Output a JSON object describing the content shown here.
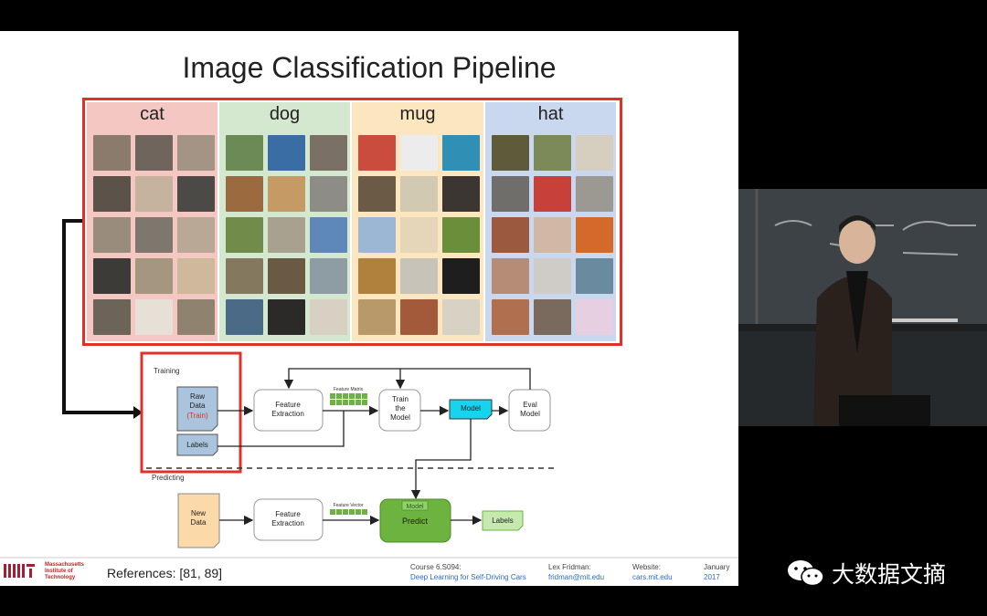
{
  "slide": {
    "title": "Image Classification Pipeline",
    "categories": [
      {
        "label": "cat",
        "bg": "#f4c7c3"
      },
      {
        "label": "dog",
        "bg": "#d4e7cf"
      },
      {
        "label": "mug",
        "bg": "#fbe6bf"
      },
      {
        "label": "hat",
        "bg": "#c9d8ef"
      }
    ],
    "diagram": {
      "training_label": "Training",
      "predicting_label": "Predicting",
      "raw_data_line1": "Raw",
      "raw_data_line2": "Data",
      "raw_data_train": "(Train)",
      "labels_box": "Labels",
      "feature_extraction_line1": "Feature",
      "feature_extraction_line2": "Extraction",
      "feature_matrix_label": "Feature Matrix",
      "train_line1": "Train",
      "train_line2": "the",
      "train_line3": "Model",
      "model_box": "Model",
      "eval_line1": "Eval",
      "eval_line2": "Model",
      "new_data_line1": "New",
      "new_data_line2": "Data",
      "feature_extraction2_line1": "Feature",
      "feature_extraction2_line2": "Extraction",
      "feature_vector_label": "Feature Vector",
      "predict_model_tag": "Model",
      "predict_label": "Predict",
      "output_labels": "Labels"
    },
    "footer": {
      "mit_line1": "Massachusetts",
      "mit_line2": "Institute of",
      "mit_line3": "Technology",
      "references": "References: [81, 89]",
      "course_line1": "Course 6.S094:",
      "course_line2": "Deep Learning for Self-Driving Cars",
      "author_line1": "Lex Fridman:",
      "author_line2": "fridman@mit.edu",
      "website_line1": "Website:",
      "website_line2": "cars.mit.edu",
      "date_line1": "January",
      "date_line2": "2017"
    }
  },
  "watermark": {
    "text": "大数据文摘"
  },
  "colors": {
    "accent_red": "#e0302a",
    "model_cyan": "#16d4f0",
    "predict_green": "#6db33f",
    "feature_green": "#6db33f",
    "raw_data_blue": "#a9c4dc",
    "new_data_orange": "#fcd9a8"
  }
}
